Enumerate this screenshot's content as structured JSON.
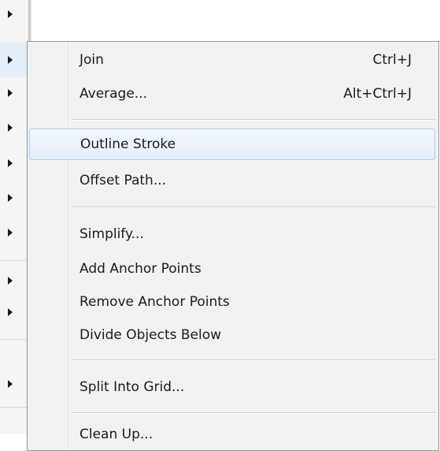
{
  "submenu": {
    "items": [
      {
        "label": "Join",
        "shortcut": "Ctrl+J"
      },
      {
        "label": "Average...",
        "shortcut": "Alt+Ctrl+J"
      },
      {
        "label": "Outline Stroke",
        "shortcut": ""
      },
      {
        "label": "Offset Path...",
        "shortcut": ""
      },
      {
        "label": "Simplify...",
        "shortcut": ""
      },
      {
        "label": "Add Anchor Points",
        "shortcut": ""
      },
      {
        "label": "Remove Anchor Points",
        "shortcut": ""
      },
      {
        "label": "Divide Objects Below",
        "shortcut": ""
      },
      {
        "label": "Split Into Grid...",
        "shortcut": ""
      },
      {
        "label": "Clean Up...",
        "shortcut": ""
      }
    ],
    "highlighted_item": "Outline Stroke"
  },
  "parent_menu": {
    "submenu_arrow_icon": "chevron-right-icon"
  },
  "colors": {
    "highlight_border": "#aecdec",
    "menu_background": "#f2f2f2"
  }
}
